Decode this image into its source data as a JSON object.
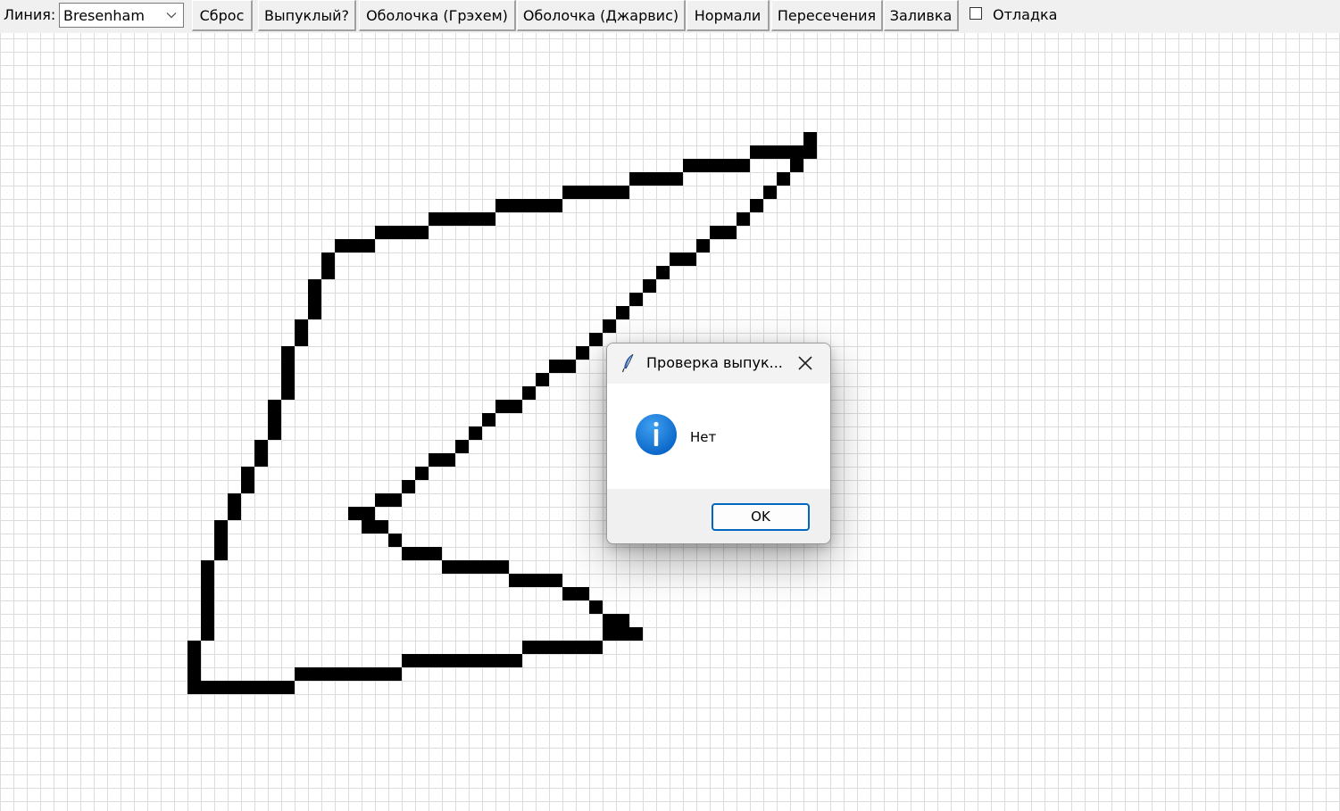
{
  "toolbar": {
    "line_label": "Линия:",
    "line_algorithm": "Bresenham",
    "buttons": {
      "reset": "Сброс",
      "convex": "Выпуклый?",
      "hull_graham": "Оболочка (Грэхем)",
      "hull_jarvis": "Оболочка (Джарвис)",
      "normals": "Нормали",
      "intersections": "Пересечения",
      "fill": "Заливка"
    },
    "debug_label": "Отладка",
    "debug_checked": false
  },
  "canvas": {
    "grid_color": "#dcdcdc",
    "pixel_color": "#000000"
  },
  "dialog": {
    "title": "Проверка выпук...",
    "message": "Нет",
    "ok_label": "OK",
    "icon": "info-icon",
    "accent_color": "#0067c0"
  }
}
